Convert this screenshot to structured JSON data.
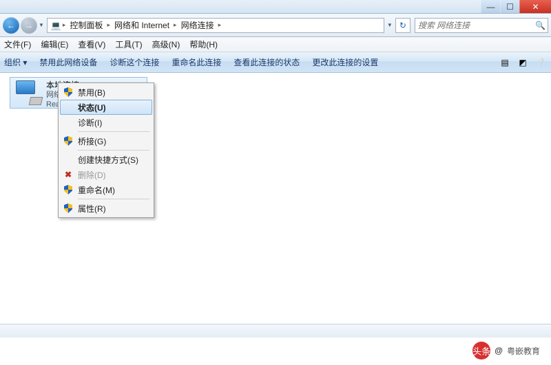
{
  "titlebar": {
    "min_glyph": "—",
    "max_glyph": "☐",
    "close_glyph": "✕"
  },
  "nav": {
    "back_glyph": "←",
    "fwd_glyph": "→",
    "drop_glyph": "▼",
    "refresh_glyph": "↻",
    "breadcrumb": [
      "控制面板",
      "网络和 Internet",
      "网络连接"
    ],
    "sep": "▸"
  },
  "search": {
    "placeholder": "搜索 网络连接",
    "mag": "🔍"
  },
  "menus": [
    "文件(F)",
    "编辑(E)",
    "查看(V)",
    "工具(T)",
    "高级(N)",
    "帮助(H)"
  ],
  "toolbar": {
    "org": "组织 ▾",
    "items": [
      "禁用此网络设备",
      "诊断这个连接",
      "重命名此连接",
      "查看此连接的状态",
      "更改此连接的设置"
    ]
  },
  "connection": {
    "name": "本地连接",
    "line2": "网络",
    "line3": "Real..."
  },
  "context_menu": {
    "disable": "禁用(B)",
    "status": "状态(U)",
    "diagnose": "诊断(I)",
    "bridge": "桥接(G)",
    "shortcut": "创建快捷方式(S)",
    "delete": "删除(D)",
    "rename": "重命名(M)",
    "properties": "属性(R)"
  },
  "watermark": {
    "badge": "头条",
    "at": "@",
    "name": "粤嵌教育"
  }
}
